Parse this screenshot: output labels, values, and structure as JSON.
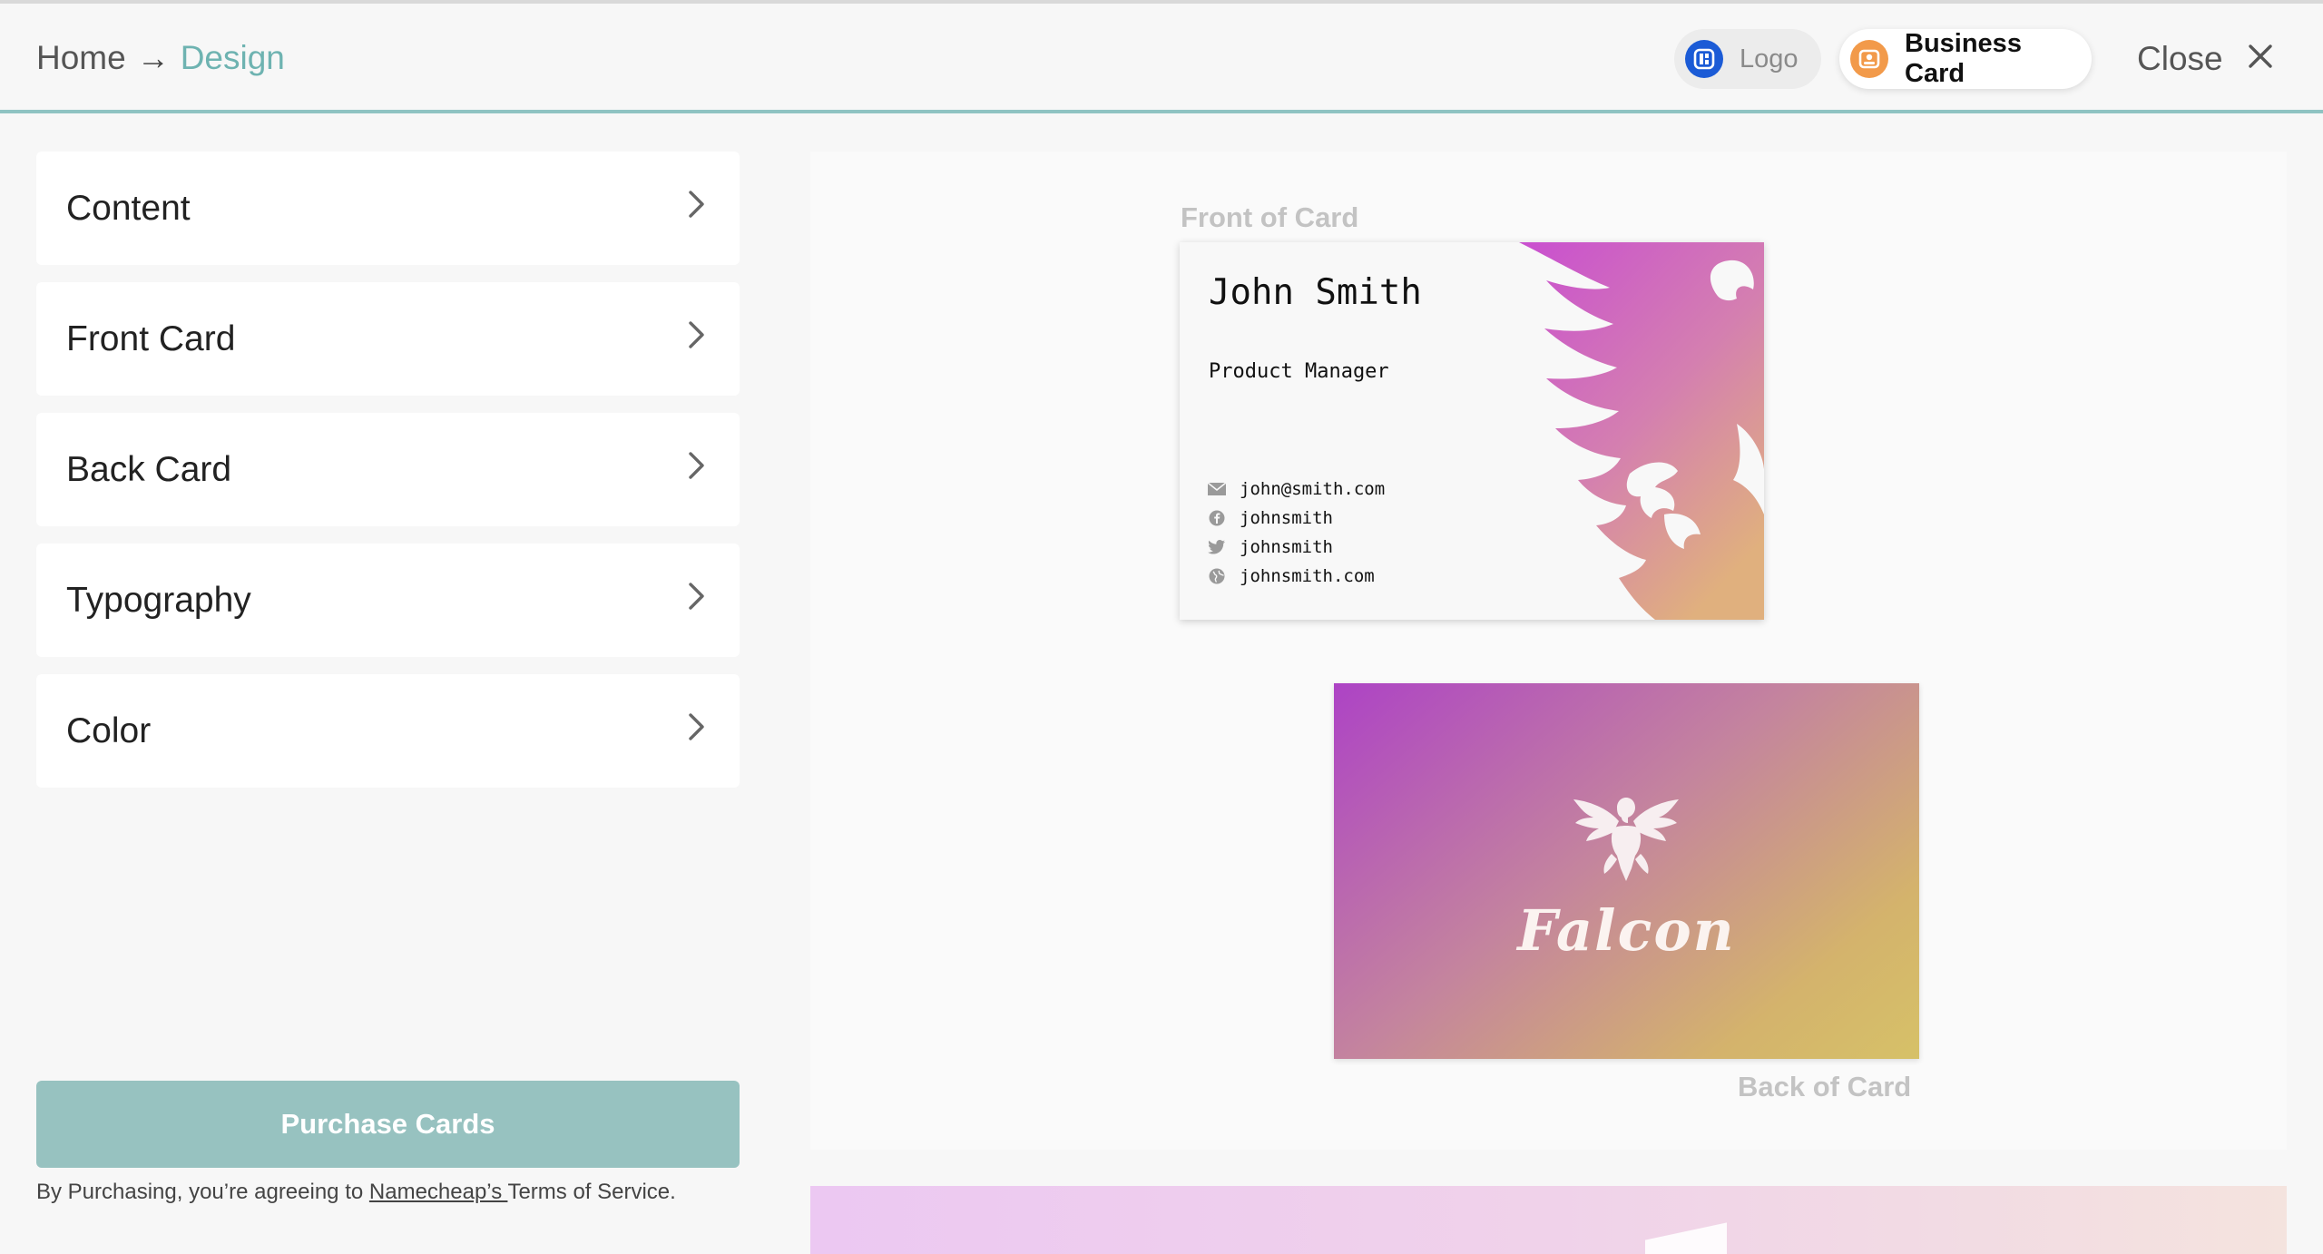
{
  "header": {
    "breadcrumb": {
      "home": "Home",
      "arrow": "→",
      "current": "Design"
    },
    "modes": [
      {
        "label": "Logo",
        "icon": "logo-builder-icon",
        "active": false
      },
      {
        "label": "Business Card",
        "icon": "business-card-icon",
        "active": true
      }
    ],
    "close_label": "Close"
  },
  "sidebar": {
    "items": [
      {
        "label": "Content"
      },
      {
        "label": "Front Card"
      },
      {
        "label": "Back Card"
      },
      {
        "label": "Typography"
      },
      {
        "label": "Color"
      }
    ],
    "purchase_label": "Purchase Cards",
    "terms": {
      "prefix": "By Purchasing, you’re agreeing to ",
      "link": "Namecheap’s ",
      "suffix": "Terms of Service."
    }
  },
  "preview": {
    "front_label": "Front of Card",
    "back_label": "Back of Card",
    "front_card": {
      "name": "John Smith",
      "title": "Product Manager",
      "contacts": [
        {
          "icon": "email-icon",
          "text": "john@smith.com"
        },
        {
          "icon": "facebook-icon",
          "text": "johnsmith"
        },
        {
          "icon": "twitter-icon",
          "text": "johnsmith"
        },
        {
          "icon": "globe-icon",
          "text": "johnsmith.com"
        }
      ]
    },
    "back_card": {
      "brand": "Falcon"
    }
  },
  "colors": {
    "accent": "#6eb3b1",
    "header_rule": "#8fc3c2",
    "purchase_button": "#97c2c0",
    "gradient_start": "#ad43c5",
    "gradient_end": "#d6c168"
  }
}
